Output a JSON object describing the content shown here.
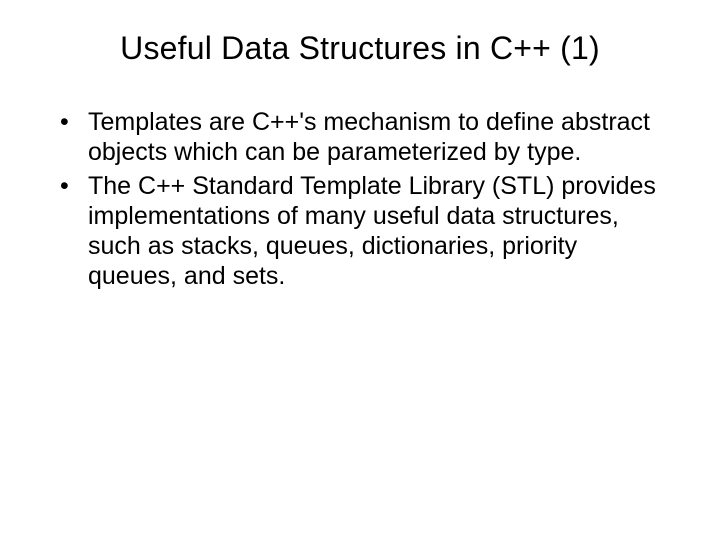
{
  "slide": {
    "title": "Useful Data Structures in C++ (1)",
    "bullets": [
      "Templates are C++'s mechanism to define abstract objects which can be parameterized by type.",
      "The C++ Standard Template Library (STL) provides implementations of many useful data structures, such as stacks, queues, dictionaries, priority queues, and sets."
    ]
  }
}
